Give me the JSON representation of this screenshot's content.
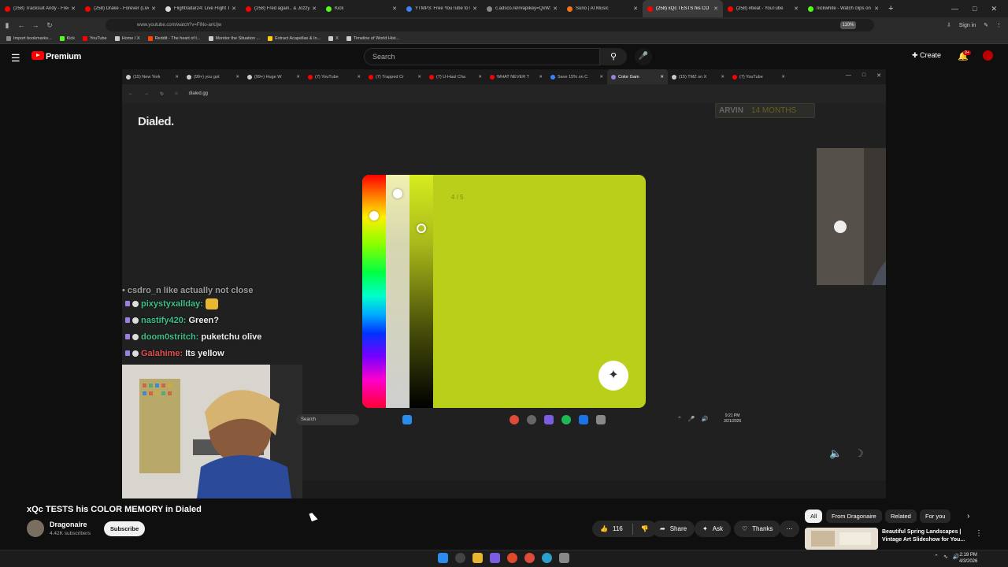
{
  "browser": {
    "tabs": [
      {
        "label": "(258) Tracksuit Andy - Free",
        "color": "#ff0000"
      },
      {
        "label": "(258) Drake - Forever (Live",
        "color": "#ff0000"
      },
      {
        "label": "Flightradar24: Live Flight Tr",
        "color": "#dddddd"
      },
      {
        "label": "(258) Fred again.. & Jozzy",
        "color": "#ff0000"
      },
      {
        "label": "Kick",
        "color": "#53fc18"
      },
      {
        "label": "YTMP3: Free YouTube to M",
        "color": "#3b82f6"
      },
      {
        "label": "c.adsco.re/r#apikey=QxW3AwA",
        "color": "#888888"
      },
      {
        "label": "Suno | AI Music",
        "color": "#f97316"
      },
      {
        "label": "(258) xQc TESTS his CO",
        "color": "#ff0000",
        "active": true
      },
      {
        "label": "(258) #beat - YouTube",
        "color": "#ff0000"
      },
      {
        "label": "nickwhite - Watch clips on K",
        "color": "#53fc18"
      }
    ],
    "url": "www.youtube.com/watch?v=FlNo-anUjw",
    "zoom": "110%",
    "signin_label": "Sign in",
    "bookmarks": [
      {
        "label": "Import bookmarks...",
        "color": "#888888"
      },
      {
        "label": "Kick",
        "color": "#53fc18"
      },
      {
        "label": "YouTube",
        "color": "#ff0000"
      },
      {
        "label": "Home / X",
        "color": "#cccccc"
      },
      {
        "label": "Reddit - The heart of t...",
        "color": "#ff4500"
      },
      {
        "label": "Monitor the Situation ...",
        "color": "#cccccc"
      },
      {
        "label": "Extract Acapellas & In...",
        "color": "#facc15"
      },
      {
        "label": "X",
        "color": "#cccccc"
      },
      {
        "label": "Timeline of World Hist...",
        "color": "#cccccc"
      }
    ]
  },
  "youtube": {
    "logo_text": "Premium",
    "search_placeholder": "Search",
    "create_label": "Create",
    "notif_count": "9+",
    "video_title": "xQc TESTS his COLOR MEMORY in Dialed",
    "channel_name": "Dragonaire",
    "subscribers": "4.42K subscribers",
    "subscribe_label": "Subscribe",
    "like_count": "116",
    "share_label": "Share",
    "ask_label": "Ask",
    "thanks_label": "Thanks",
    "chips": [
      "All",
      "From Dragonaire",
      "Related",
      "For you"
    ],
    "rec_title": "Beautiful Spring Landscapes | Vintage Art Slideshow for You..."
  },
  "stream": {
    "inner_tabs": [
      {
        "label": "(15) New York",
        "color": "#cccccc"
      },
      {
        "label": "(99+) you got ",
        "color": "#cccccc"
      },
      {
        "label": "(99+) Huge W",
        "color": "#cccccc"
      },
      {
        "label": "(7) YouTube",
        "color": "#ff0000"
      },
      {
        "label": "(7) Trapped Cr",
        "color": "#ff0000"
      },
      {
        "label": "(7) U-Haul Cha",
        "color": "#ff0000"
      },
      {
        "label": "WHAT NEVER T",
        "color": "#ff0000"
      },
      {
        "label": "Save 15% on C",
        "color": "#3b82f6"
      },
      {
        "label": "Color Gam",
        "color": "#9b7fe0",
        "active": true
      },
      {
        "label": "(15) TMZ on X",
        "color": "#cccccc"
      },
      {
        "label": "(7) YouTube",
        "color": "#ff0000"
      }
    ],
    "inner_url": "dialed.gg",
    "site_logo": "Dialed.",
    "player_name": "ARVIN",
    "player_streak": "14 MONTHS",
    "round": "4 / 5",
    "current_color": "#b9cf1a",
    "chat": [
      {
        "user": "pixystyxallday:",
        "text": "",
        "color": "#3fbf8a"
      },
      {
        "user": "nastify420:",
        "text": "Green?",
        "color": "#3fbf8a"
      },
      {
        "user": "doom0stritch:",
        "text": "puketchu olive",
        "color": "#3fbf8a"
      },
      {
        "user": "Galahime:",
        "text": "Its yellow",
        "color": "#e05050"
      }
    ],
    "chat_cut_text": "• csdro_n like actually not close",
    "taskbar_search": "Search",
    "inner_time": "9:21 PM",
    "inner_date": "3/21/2026"
  },
  "os": {
    "time": "2:19 PM",
    "date": "4/3/2026"
  }
}
